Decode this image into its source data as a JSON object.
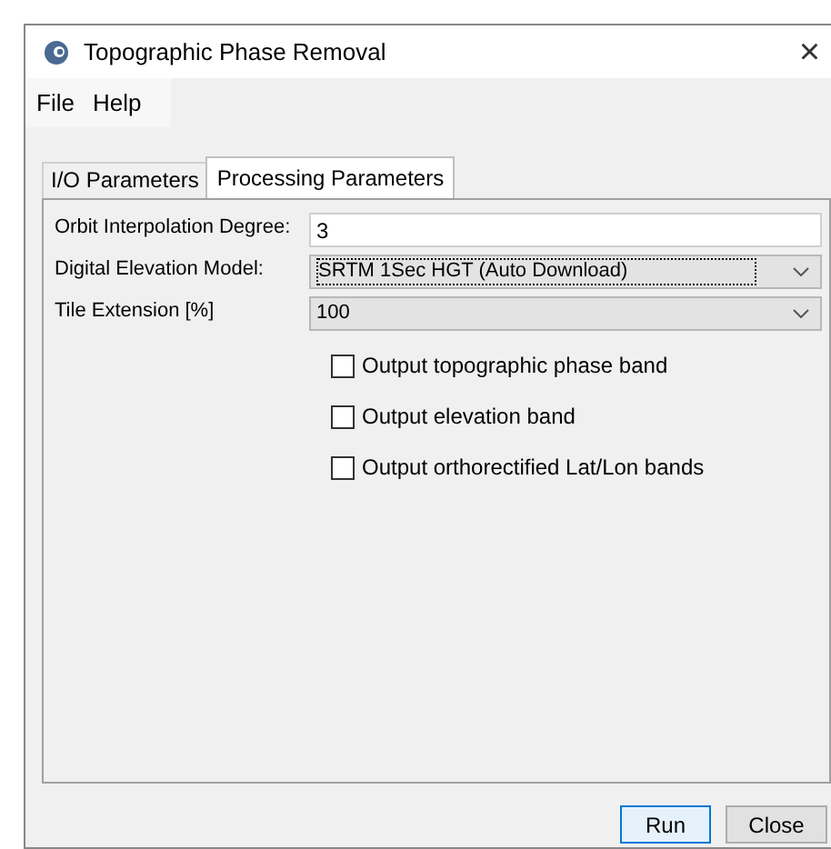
{
  "window": {
    "title": "Topographic Phase Removal",
    "close": "×"
  },
  "menu": [
    "File",
    "Help"
  ],
  "tabs": [
    {
      "label": "I/O Parameters",
      "selected": false
    },
    {
      "label": "Processing Parameters",
      "selected": true
    }
  ],
  "fields": [
    {
      "kind": "text",
      "label": "Orbit Interpolation Degree:",
      "value": "3"
    },
    {
      "kind": "dropdown",
      "label": "Digital Elevation Model:",
      "value": "SRTM 1Sec HGT (Auto Download)",
      "focused": true
    },
    {
      "kind": "dropdown",
      "label": "Tile Extension [%]",
      "value": "100",
      "focused": false
    }
  ],
  "checkboxes": [
    {
      "label": "Output topographic phase band",
      "checked": false
    },
    {
      "label": "Output elevation band",
      "checked": false
    },
    {
      "label": "Output orthorectified Lat/Lon bands",
      "checked": false
    }
  ],
  "buttons": [
    {
      "label": "Run",
      "default": true
    },
    {
      "label": "Close",
      "default": false
    }
  ]
}
